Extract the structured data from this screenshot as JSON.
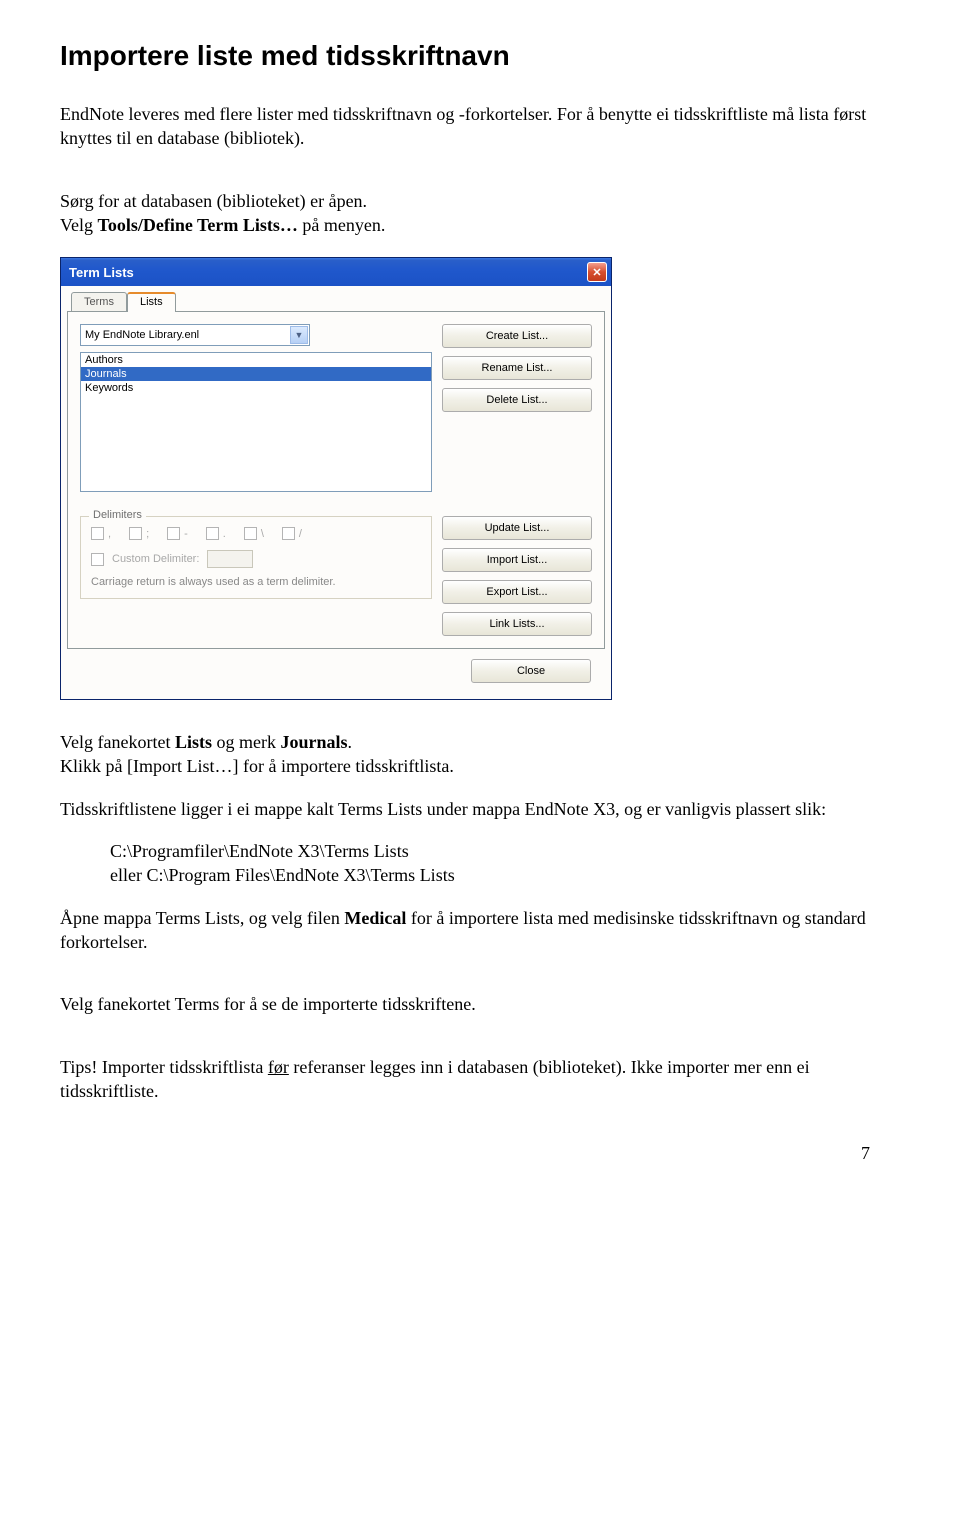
{
  "heading": "Importere liste med tidsskriftnavn",
  "para1": "EndNote leveres med flere lister med tidsskriftnavn og -forkortelser. For å benytte ei tidsskriftliste må lista først knyttes til en database (bibliotek).",
  "para2a": "Sørg for at databasen (biblioteket) er åpen.",
  "para2b_pre": "Velg ",
  "para2b_bold": "Tools/Define Term Lists…",
  "para2b_post": " på menyen.",
  "para3a": "Velg fanekortet ",
  "para3a_b1": "Lists",
  "para3a_mid": " og merk ",
  "para3a_b2": "Journals",
  "para3a_end": ".",
  "para3b": "Klikk på [Import List…] for å importere tidsskriftlista.",
  "para4": "Tidsskriftlistene ligger i ei mappe kalt Terms Lists under mappa EndNote X3, og er vanligvis plassert slik:",
  "path1": "C:\\Programfiler\\EndNote X3\\Terms Lists",
  "path2": "eller  C:\\Program Files\\EndNote X3\\Terms Lists",
  "para5_pre": "Åpne mappa Terms Lists, og velg filen ",
  "para5_bold": "Medical",
  "para5_post": " for å importere lista med medisinske tidsskriftnavn og standard forkortelser.",
  "para6": "Velg fanekortet Terms for å se de importerte tidsskriftene.",
  "para7_pre": "Tips! Importer tidsskriftlista ",
  "para7_u": "før",
  "para7_post": " referanser legges inn i databasen (biblioteket). Ikke importer mer enn ei tidsskriftliste.",
  "page_number": "7",
  "dialog": {
    "title": "Term Lists",
    "tabs": {
      "terms": "Terms",
      "lists": "Lists"
    },
    "library": "My EndNote Library.enl",
    "items": {
      "authors": "Authors",
      "journals": "Journals",
      "keywords": "Keywords"
    },
    "buttons": {
      "create": "Create List...",
      "rename": "Rename List...",
      "delete": "Delete List...",
      "update": "Update List...",
      "import": "Import List...",
      "export": "Export List...",
      "link": "Link Lists...",
      "close": "Close"
    },
    "delimiters": {
      "label": "Delimiters",
      "comma": ",",
      "semicolon": ";",
      "dash": "-",
      "dot": ".",
      "backslash": "\\",
      "slash": "/",
      "custom": "Custom Delimiter:",
      "note": "Carriage return is always used as a term delimiter."
    }
  }
}
